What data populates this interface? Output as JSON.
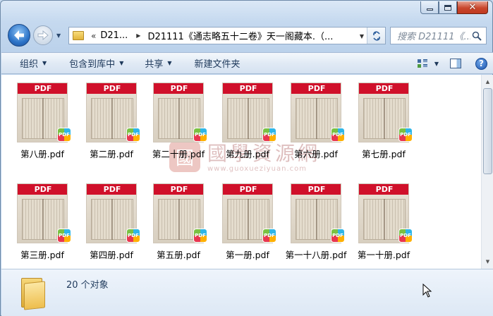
{
  "window": {
    "caption_buttons": {
      "minimize": "minimize",
      "maximize": "maximize",
      "close": "✕"
    }
  },
  "nav": {
    "address": {
      "chevron": "«",
      "segment1": "D21...",
      "segment2": "D21111《通志略五十二卷》天一阁藏本.（..."
    },
    "search_placeholder": "搜索 D21111《..."
  },
  "toolbar": {
    "organize": "组织",
    "include_in_library": "包含到库中",
    "share": "共享",
    "new_folder": "新建文件夹"
  },
  "thumbnail_label": "PDF",
  "badge_label": "PDF",
  "watermark": {
    "seal": "國",
    "title": "國學資源網",
    "url": "www.guoxueziyuan.com"
  },
  "files": [
    {
      "name": "第八册.pdf"
    },
    {
      "name": "第二册.pdf"
    },
    {
      "name": "第二十册.pdf"
    },
    {
      "name": "第九册.pdf"
    },
    {
      "name": "第六册.pdf"
    },
    {
      "name": "第七册.pdf"
    },
    {
      "name": "第三册.pdf"
    },
    {
      "name": "第四册.pdf"
    },
    {
      "name": "第五册.pdf"
    },
    {
      "name": "第一册.pdf"
    },
    {
      "name": "第一十八册.pdf"
    },
    {
      "name": "第一十册.pdf"
    }
  ],
  "details": {
    "count": "20 个对象"
  },
  "colors": {
    "pdf_band": "#d0102a",
    "window_bg": "#c9dcf1",
    "accent": "#2d74c8"
  }
}
